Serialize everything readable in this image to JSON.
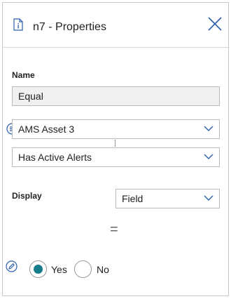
{
  "header": {
    "title": "n7 - Properties",
    "doc_icon": "document-info-icon",
    "close_icon": "close-icon"
  },
  "form": {
    "name_label": "Name",
    "name_value": "Equal",
    "asset_select_value": "AMS Asset 3",
    "condition_select_value": "Has Active Alerts",
    "display_label": "Display",
    "display_select_value": "Field",
    "operator_symbol": "="
  },
  "radio": {
    "yes_label": "Yes",
    "no_label": "No",
    "selected": "Yes"
  },
  "icons": {
    "list": "list-circle-icon",
    "pencil": "pencil-circle-icon",
    "chevron": "chevron-down-icon"
  },
  "colors": {
    "accent": "#2a5fae",
    "radio_selected": "#177c8a"
  }
}
